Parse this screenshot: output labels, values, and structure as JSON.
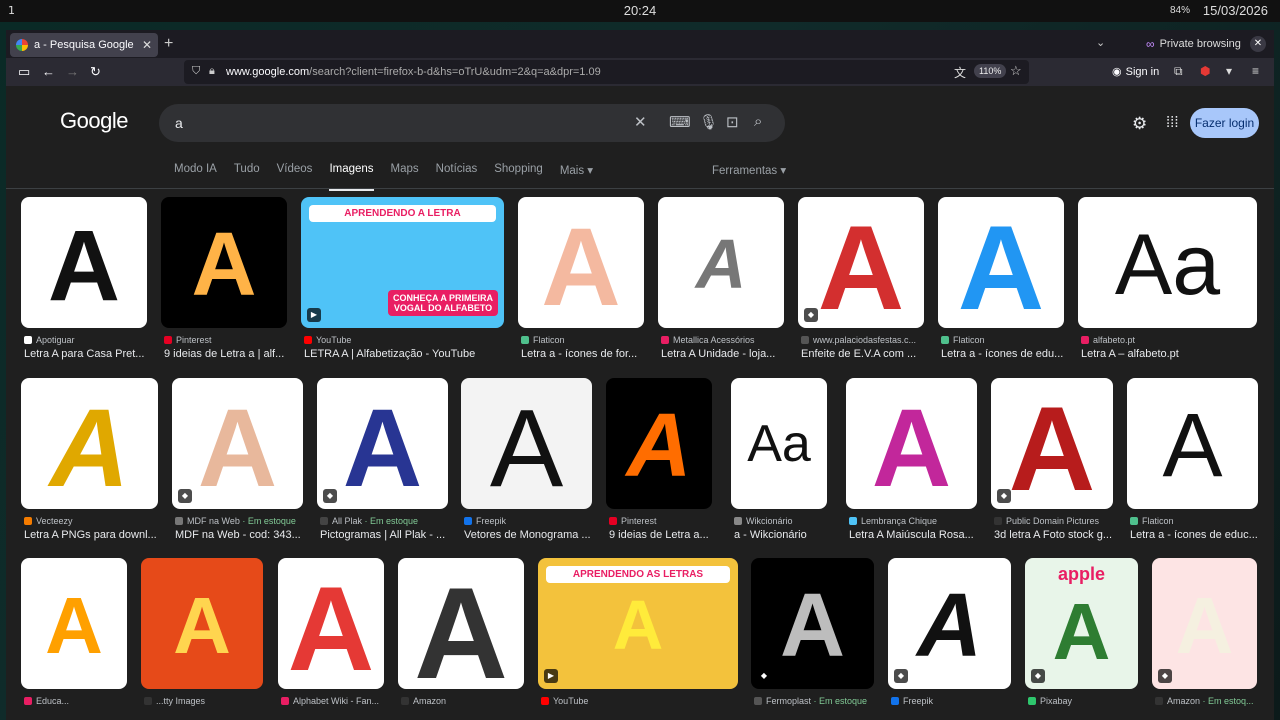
{
  "system": {
    "workspace": "1",
    "clock": "20:24",
    "battery": "84%",
    "date": "15/03/2026"
  },
  "browser": {
    "tab_title": "a - Pesquisa Google",
    "private_label": "Private browsing",
    "url_domain": "www.google.com",
    "url_path": "/search?client=firefox-b-d&hs=oTrU&udm=2&q=a&dpr=1.09",
    "zoom": "110%",
    "signin": "Sign in"
  },
  "google": {
    "logo": "Google",
    "query": "a",
    "login": "Fazer login",
    "tabs": [
      "Modo IA",
      "Tudo",
      "Vídeos",
      "Imagens",
      "Maps",
      "Notícias",
      "Shopping",
      "Mais"
    ],
    "tools": "Ferramentas"
  },
  "results": [
    {
      "source": "Apotiguar",
      "title": "Letra A para Casa Pret...",
      "color": "#ffffff",
      "fav": "#ffffff"
    },
    {
      "source": "Pinterest",
      "title": "9 ideias de Letra a | alf...",
      "color": "#000000",
      "fav": "#e60023"
    },
    {
      "source": "YouTube",
      "title": "LETRA A | Alfabetização - YouTube",
      "color": "#4fc3f7",
      "fav": "#ff0000",
      "banner1": "APRENDENDO A LETRA",
      "banner2": "CONHEÇA A PRIMEIRA VOGAL DO ALFABETO"
    },
    {
      "source": "Flaticon",
      "title": "Letra a - ícones de for...",
      "color": "#ffffff",
      "fav": "#4fc08d"
    },
    {
      "source": "Metallica Acessórios",
      "title": "Letra A Unidade - loja...",
      "color": "#ffffff",
      "fav": "#e91e63"
    },
    {
      "source": "www.palaciodasfestas.c...",
      "title": "Enfeite de E.V.A com ...",
      "color": "#ffffff",
      "fav": "#555"
    },
    {
      "source": "Flaticon",
      "title": "Letra a - ícones de edu...",
      "color": "#ffffff",
      "fav": "#4fc08d"
    },
    {
      "source": "alfabeto.pt",
      "title": "Letra A – alfabeto.pt",
      "color": "#ffffff",
      "fav": "#e91e63",
      "text": "Aa"
    },
    {
      "source": "Vecteezy",
      "title": "Letra A PNGs para downl...",
      "color": "#ffffff",
      "fav": "#f57c00"
    },
    {
      "source": "MDF na Web",
      "stock": "Em estoque",
      "title": "MDF na Web - cod: 343...",
      "color": "#ffffff",
      "fav": "#777"
    },
    {
      "source": "All Plak",
      "stock": "Em estoque",
      "title": "Pictogramas | All Plak - ...",
      "color": "#ffffff",
      "fav": "#444"
    },
    {
      "source": "Freepik",
      "title": "Vetores de Monograma ...",
      "color": "#f3f3f3",
      "fav": "#1273eb"
    },
    {
      "source": "Pinterest",
      "title": "9 ideias de Letra a...",
      "color": "#000000",
      "fav": "#e60023"
    },
    {
      "source": "Wikcionário",
      "title": "a - Wikcionário",
      "color": "#ffffff",
      "fav": "#888",
      "text": "Aa"
    },
    {
      "source": "Lembrança Chique",
      "title": "Letra A Maiúscula Rosa...",
      "color": "#ffffff",
      "fav": "#4fc3f7"
    },
    {
      "source": "Public Domain Pictures",
      "title": "3d letra A Foto stock g...",
      "color": "#ffffff",
      "fav": "#333"
    },
    {
      "source": "Flaticon",
      "title": "Letra a - ícones de educ...",
      "color": "#ffffff",
      "fav": "#4fc08d"
    },
    {
      "source": "Educa...",
      "title": "",
      "color": "#ffffff",
      "fav": "#e91e63"
    },
    {
      "source": "...tty Images",
      "title": "",
      "color": "#e64a19",
      "fav": "#333"
    },
    {
      "source": "Alphabet Wiki - Fan...",
      "title": "",
      "color": "#ffffff",
      "fav": "#e91e63"
    },
    {
      "source": "Amazon",
      "title": "",
      "color": "#ffffff",
      "fav": "#333"
    },
    {
      "source": "YouTube",
      "title": "",
      "color": "#f3c23c",
      "fav": "#ff0000",
      "banner1": "APRENDENDO AS LETRAS"
    },
    {
      "source": "Fermoplast",
      "stock": "Em estoque",
      "title": "",
      "color": "#000000",
      "fav": "#555"
    },
    {
      "source": "Freepik",
      "title": "",
      "color": "#ffffff",
      "fav": "#1273eb"
    },
    {
      "source": "Pixabay",
      "title": "",
      "color": "#e8f5e9",
      "fav": "#2ec66d",
      "text": "apple"
    },
    {
      "source": "Amazon",
      "stock": "Em estoq...",
      "title": "",
      "color": "#fde4e4",
      "fav": "#333"
    }
  ]
}
